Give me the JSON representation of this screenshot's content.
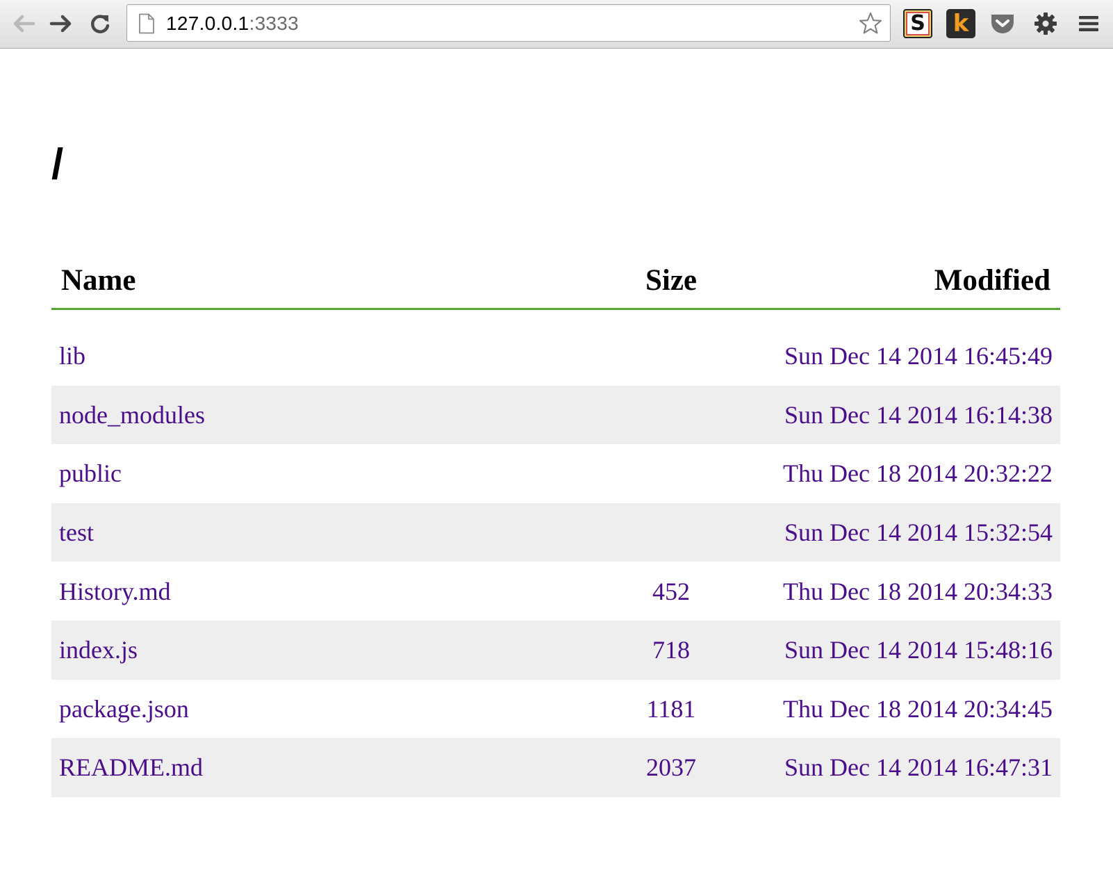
{
  "browser": {
    "url_host": "127.0.0.1",
    "url_port": ":3333"
  },
  "page": {
    "title": "/"
  },
  "table": {
    "headers": {
      "name": "Name",
      "size": "Size",
      "modified": "Modified"
    },
    "rows": [
      {
        "name": "lib",
        "size": "",
        "modified": "Sun Dec 14 2014 16:45:49"
      },
      {
        "name": "node_modules",
        "size": "",
        "modified": "Sun Dec 14 2014 16:14:38"
      },
      {
        "name": "public",
        "size": "",
        "modified": "Thu Dec 18 2014 20:32:22"
      },
      {
        "name": "test",
        "size": "",
        "modified": "Sun Dec 14 2014 15:32:54"
      },
      {
        "name": "History.md",
        "size": "452",
        "modified": "Thu Dec 18 2014 20:34:33"
      },
      {
        "name": "index.js",
        "size": "718",
        "modified": "Sun Dec 14 2014 15:48:16"
      },
      {
        "name": "package.json",
        "size": "1181",
        "modified": "Thu Dec 18 2014 20:34:45"
      },
      {
        "name": "README.md",
        "size": "2037",
        "modified": "Sun Dec 14 2014 16:47:31"
      }
    ]
  },
  "colors": {
    "header_rule": "#57a832",
    "link": "#4b0e8a",
    "alt_row": "#eeeeee"
  },
  "icons": {
    "extension_s": "S",
    "extension_k": "k"
  }
}
